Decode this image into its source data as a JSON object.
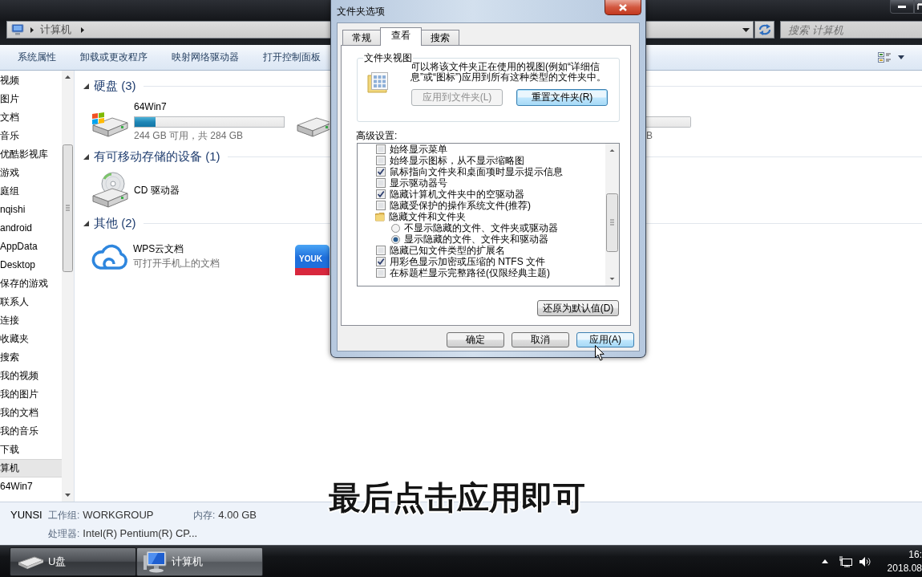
{
  "window": {
    "address_path": [
      "计算机"
    ],
    "search": {
      "placeholder": "搜索 计算机"
    }
  },
  "toolbar": {
    "items": [
      "系统属性",
      "卸载或更改程序",
      "映射网络驱动器",
      "打开控制面板"
    ]
  },
  "sidebar": {
    "items": [
      {
        "label": "视频",
        "selected": false
      },
      {
        "label": "图片",
        "selected": false
      },
      {
        "label": "文档",
        "selected": false
      },
      {
        "label": "音乐",
        "selected": false
      },
      {
        "label": "优酷影视库",
        "selected": false
      },
      {
        "label": "游戏",
        "selected": false
      },
      {
        "label": "庭组",
        "selected": false
      },
      {
        "label": "nqishi",
        "selected": false
      },
      {
        "label": "android",
        "selected": false
      },
      {
        "label": "AppData",
        "selected": false
      },
      {
        "label": "Desktop",
        "selected": false
      },
      {
        "label": "保存的游戏",
        "selected": false
      },
      {
        "label": "联系人",
        "selected": false
      },
      {
        "label": "连接",
        "selected": false
      },
      {
        "label": "收藏夹",
        "selected": false
      },
      {
        "label": "搜索",
        "selected": false
      },
      {
        "label": "我的视频",
        "selected": false
      },
      {
        "label": "我的图片",
        "selected": false
      },
      {
        "label": "我的文档",
        "selected": false
      },
      {
        "label": "我的音乐",
        "selected": false
      },
      {
        "label": "下载",
        "selected": false
      },
      {
        "label": "算机",
        "selected": true
      },
      {
        "label": "64Win7",
        "selected": false
      }
    ]
  },
  "content": {
    "groups": [
      {
        "title": "硬盘 (3)",
        "expanded": true,
        "items": [
          {
            "kind": "system_drive",
            "name": "64Win7",
            "level": 0.14,
            "detail": "244 GB 可用，共 284 GB"
          },
          {
            "kind": "drive_covered"
          },
          {
            "kind": "drive_tail",
            "detail": "B"
          }
        ]
      },
      {
        "title": "有可移动存储的设备 (1)",
        "expanded": true,
        "items": [
          {
            "kind": "optical_drive",
            "name": "CD 驱动器"
          }
        ]
      },
      {
        "title": "其他 (2)",
        "expanded": true,
        "items": [
          {
            "kind": "cloud_app",
            "name": "WPS云文档",
            "detail": "可打开手机上的文档"
          },
          {
            "kind": "video_app_covered",
            "logo": "YOUK"
          }
        ]
      }
    ]
  },
  "details_pane": {
    "computer_name": "YUNSI",
    "fields": [
      {
        "label": "工作组:",
        "value": "WORKGROUP"
      },
      {
        "label": "内存:",
        "value": "4.00 GB"
      },
      {
        "label": "处理器:",
        "value": "Intel(R) Pentium(R) CP..."
      }
    ]
  },
  "dialog": {
    "title": "文件夹选项",
    "tabs": [
      {
        "label": "常规",
        "selected": false
      },
      {
        "label": "查看",
        "selected": true
      },
      {
        "label": "搜索",
        "selected": false
      }
    ],
    "folder_views": {
      "title": "文件夹视图",
      "description": "可以将该文件夹正在使用的视图(例如“详细信息”或“图标”)应用到所有这种类型的文件夹中。",
      "buttons": [
        {
          "label": "应用到文件夹(L)",
          "disabled": true,
          "focused": false
        },
        {
          "label": "重置文件夹(R)",
          "disabled": false,
          "focused": true
        }
      ]
    },
    "advanced": {
      "label": "高级设置:",
      "items": [
        {
          "kind": "checkbox",
          "label": "始终显示菜单",
          "checked": false
        },
        {
          "kind": "checkbox",
          "label": "始终显示图标，从不显示缩略图",
          "checked": false
        },
        {
          "kind": "checkbox",
          "label": "鼠标指向文件夹和桌面项时显示提示信息",
          "checked": true
        },
        {
          "kind": "checkbox",
          "label": "显示驱动器号",
          "checked": false
        },
        {
          "kind": "checkbox",
          "label": "隐藏计算机文件夹中的空驱动器",
          "checked": true
        },
        {
          "kind": "checkbox",
          "label": "隐藏受保护的操作系统文件(推荐)",
          "checked": false
        },
        {
          "kind": "folder",
          "label": "隐藏文件和文件夹",
          "children": [
            {
              "kind": "radio",
              "label": "不显示隐藏的文件、文件夹或驱动器",
              "selected": false
            },
            {
              "kind": "radio",
              "label": "显示隐藏的文件、文件夹和驱动器",
              "selected": true
            }
          ]
        },
        {
          "kind": "checkbox",
          "label": "隐藏已知文件类型的扩展名",
          "checked": false
        },
        {
          "kind": "checkbox",
          "label": "用彩色显示加密或压缩的 NTFS 文件",
          "checked": true
        },
        {
          "kind": "checkbox",
          "label": "在标题栏显示完整路径(仅限经典主题)",
          "checked": false
        }
      ]
    },
    "restore_button": "还原为默认值(D)",
    "buttons": [
      {
        "label": "确定",
        "hovered": false
      },
      {
        "label": "取消",
        "hovered": false
      },
      {
        "label": "应用(A)",
        "hovered": true
      }
    ]
  },
  "subtitle": "最后点击应用即可",
  "taskbar": {
    "buttons": [
      {
        "label": "U盘",
        "kind": "drive",
        "active": false
      },
      {
        "label": "计算机",
        "kind": "computer",
        "active": true
      }
    ],
    "clock": {
      "time": "16:",
      "date": "2018.08"
    }
  }
}
